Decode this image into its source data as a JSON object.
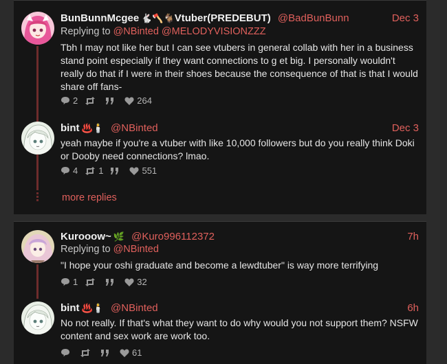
{
  "threads": [
    {
      "tweets": [
        {
          "name": "BunBunnMcgee",
          "name_emojis": "🐇🪓🐐",
          "name_suffix": "Vtuber(PREDEBUT)",
          "handle": "@BadBunBunn",
          "date": "Dec 3",
          "replying_label": "Replying to",
          "replying_to": [
            "@NBinted",
            "@MELODYVISIONZZZ"
          ],
          "text": "Tbh I may not like her but I can see vtubers in general collab with her in a business stand point especially if they want connections to g et big. I personally wouldn't really do that if I were in their shoes because the consequence of that is that I would share off fans-",
          "counts": {
            "replies": "2",
            "retweets": "",
            "quotes": "",
            "likes": "264"
          },
          "avatar": "pink-hair-anime-avatar"
        },
        {
          "name": "bint",
          "name_emojis": "♨️🕯️",
          "handle": "@NBinted",
          "date": "Dec 3",
          "text": "yeah maybe if you're a vtuber with like 10,000 followers but do you really think Doki or Dooby need connections? lmao.",
          "counts": {
            "replies": "4",
            "retweets": "1",
            "quotes": "",
            "likes": "551"
          },
          "avatar": "white-hair-anime-avatar"
        }
      ],
      "more_replies": "more replies"
    },
    {
      "tweets": [
        {
          "name": "Kurooow~",
          "name_emojis": "🌿",
          "handle": "@Kuro996112372",
          "date": "7h",
          "replying_label": "Replying to",
          "replying_to": [
            "@NBinted"
          ],
          "text": "\"I hope your oshi graduate and become a lewdtuber\" is way more terrifying",
          "counts": {
            "replies": "1",
            "retweets": "",
            "quotes": "",
            "likes": "32"
          },
          "avatar": "pastel-anime-avatar"
        },
        {
          "name": "bint",
          "name_emojis": "♨️🕯️",
          "handle": "@NBinted",
          "date": "6h",
          "text": "No not really. If that's what they want to do why would you not support them? NSFW content and sex work are work too.",
          "counts": {
            "replies": "",
            "retweets": "",
            "quotes": "",
            "likes": "61"
          },
          "avatar": "white-hair-anime-avatar"
        }
      ]
    }
  ],
  "colors": {
    "accent": "#e0605c",
    "thread_line": "#6e2c2c",
    "card_bg": "#151515",
    "page_bg": "#2b2b2b"
  }
}
